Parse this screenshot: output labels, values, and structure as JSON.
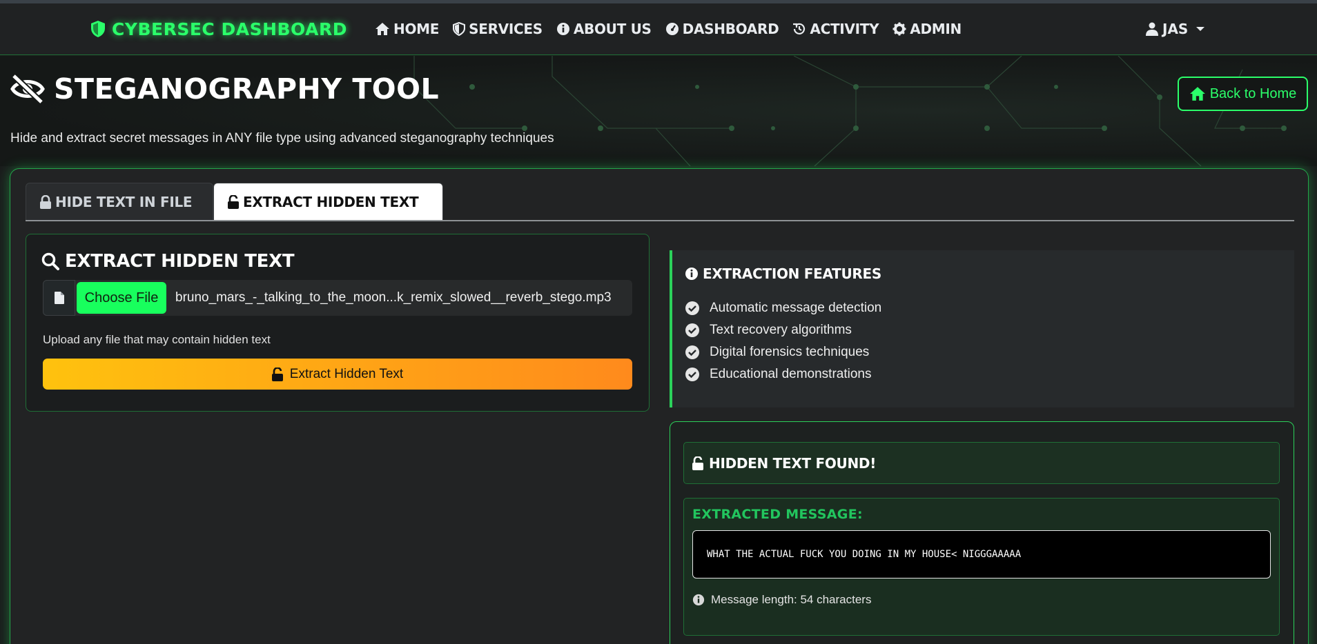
{
  "navbar": {
    "brand": "CYBERSEC DASHBOARD",
    "items": [
      {
        "label": "HOME",
        "icon": "home-icon"
      },
      {
        "label": "SERVICES",
        "icon": "shield-icon"
      },
      {
        "label": "ABOUT US",
        "icon": "info-icon"
      },
      {
        "label": "DASHBOARD",
        "icon": "gauge-icon"
      },
      {
        "label": "ACTIVITY",
        "icon": "history-icon"
      },
      {
        "label": "ADMIN",
        "icon": "gear-icon"
      }
    ],
    "user": "JAS"
  },
  "hero": {
    "title": "STEGANOGRAPHY TOOL",
    "subtitle": "Hide and extract secret messages in ANY file type using advanced steganography techniques",
    "back_button": "Back to Home"
  },
  "tabs": [
    {
      "label": "HIDE TEXT IN FILE",
      "active": false
    },
    {
      "label": "EXTRACT HIDDEN TEXT",
      "active": true
    }
  ],
  "extract_panel": {
    "title": "EXTRACT HIDDEN TEXT",
    "choose_file": "Choose File",
    "file_name": "bruno_mars_-_talking_to_the_moon...k_remix_slowed__reverb_stego.mp3",
    "help": "Upload any file that may contain hidden text",
    "button": "Extract Hidden Text"
  },
  "features": {
    "title": "EXTRACTION FEATURES",
    "items": [
      "Automatic message detection",
      "Text recovery algorithms",
      "Digital forensics techniques",
      "Educational demonstrations"
    ]
  },
  "result": {
    "found_title": "HIDDEN TEXT FOUND!",
    "message_label": "EXTRACTED MESSAGE:",
    "message": "WHAT THE ACTUAL FUCK YOU DOING IN MY HOUSE< NIGGGAAAAA",
    "length_text": "Message length: 54 characters"
  },
  "colors": {
    "accent": "#2bff6a",
    "background": "#1a1c1c",
    "warning_start": "#ffc20e",
    "warning_end": "#ff8a1c"
  }
}
